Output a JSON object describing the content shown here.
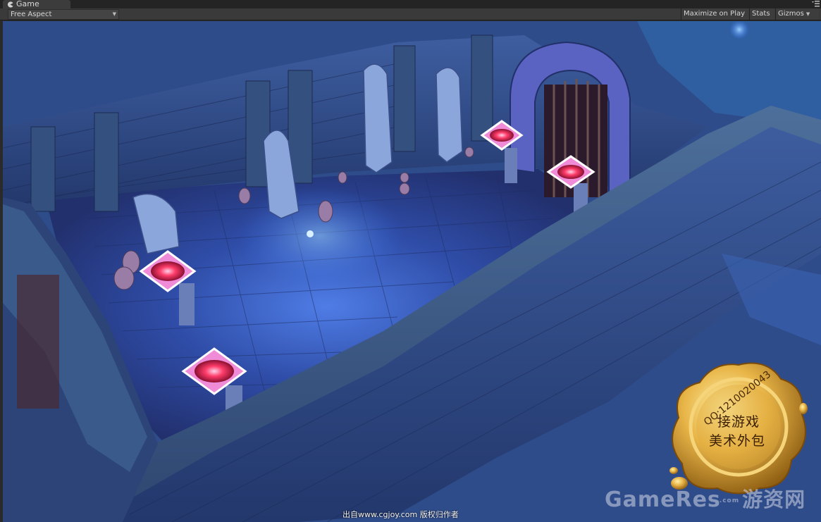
{
  "tab": {
    "title": "Game",
    "icon": "pacman-icon"
  },
  "toolbar": {
    "aspect_value": "Free Aspect",
    "maximize_label": "Maximize on Play",
    "stats_label": "Stats",
    "gizmos_label": "Gizmos"
  },
  "overlay": {
    "caption": "出自www.cgjoy.com 版权归作者",
    "brand_latin": "GameRes",
    "brand_dot": ".com",
    "brand_zh": "游资网"
  },
  "seal": {
    "qq": "QQ:1210020043",
    "line1": "接游戏",
    "line2": "美术外包"
  },
  "colors": {
    "editor_bg": "#3a3a3a",
    "viewport_bg": "#2f4c8a",
    "brazier_glow": "#ff4aa8",
    "seal_gold": "#d9a23a"
  }
}
